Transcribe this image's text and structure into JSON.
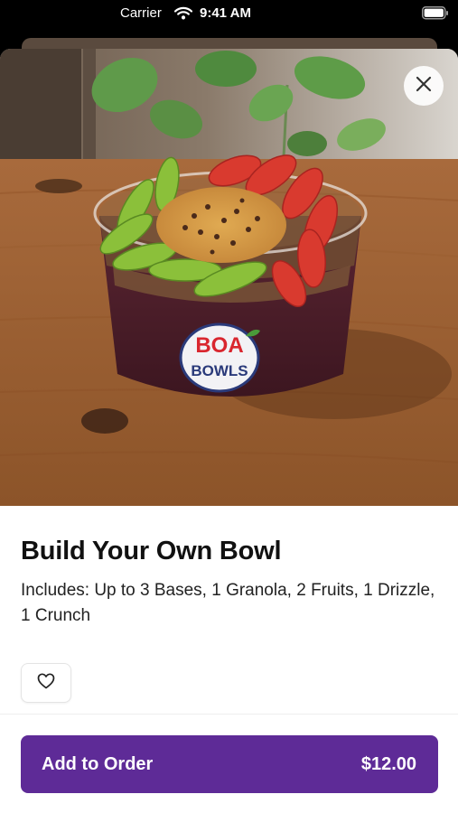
{
  "status_bar": {
    "carrier": "Carrier",
    "time": "9:41 AM"
  },
  "product": {
    "title": "Build Your Own Bowl",
    "description": "Includes: Up to 3 Bases, 1 Granola, 2 Fruits, 1 Drizzle, 1 Crunch",
    "image_logo_lines": [
      "BOA",
      "BOWLS"
    ]
  },
  "footer": {
    "button_label": "Add to Order",
    "price": "$12.00"
  },
  "colors": {
    "accent": "#5e2b97",
    "strawberry": "#d93a2f",
    "kiwi": "#8bc03a",
    "acai": "#4a1e2c"
  },
  "icons": {
    "close": "close-icon",
    "favorite": "heart-outline-icon",
    "wifi": "wifi-icon",
    "battery": "battery-icon"
  }
}
